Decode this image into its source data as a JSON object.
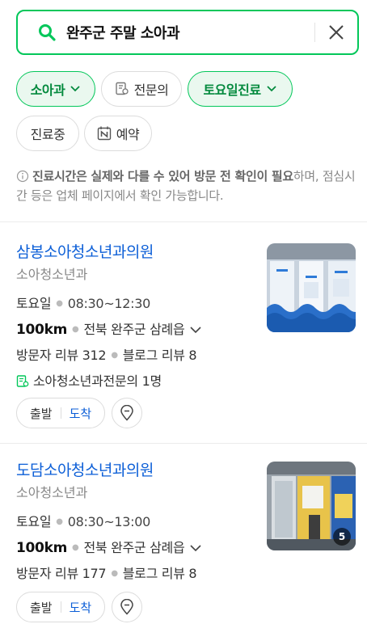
{
  "search": {
    "query": "완주군 주말 소아과"
  },
  "filters": [
    {
      "label": "소아과",
      "active": true
    },
    {
      "label": "전문의",
      "active": false
    },
    {
      "label": "토요일진료",
      "active": true
    },
    {
      "label": "진료중",
      "active": false
    },
    {
      "label": "예약",
      "active": false
    }
  ],
  "notice": {
    "bold": "진료시간은 실제와 다를 수 있어 방문 전 확인이 필요",
    "rest": "하며, 점심시간 등은 업체 페이지에서 확인 가능합니다."
  },
  "results": [
    {
      "name": "삼봉소아청소년과의원",
      "category": "소아청소년과",
      "day": "토요일",
      "hours": "08:30~12:30",
      "distance": "100km",
      "address": "전북 완주군 삼례읍",
      "visitor_reviews": "방문자 리뷰 312",
      "blog_reviews": "블로그 리뷰 8",
      "specialist": "소아청소년과전문의 1명",
      "depart": "출발",
      "arrive": "도착"
    },
    {
      "name": "도담소아청소년과의원",
      "category": "소아청소년과",
      "day": "토요일",
      "hours": "08:30~13:00",
      "distance": "100km",
      "address": "전북 완주군 삼례읍",
      "visitor_reviews": "방문자 리뷰 177",
      "blog_reviews": "블로그 리뷰 8",
      "photo_count": "5",
      "depart": "출발",
      "arrive": "도착"
    }
  ],
  "colors": {
    "accent": "#03c75a",
    "link": "#0b5ed7"
  }
}
